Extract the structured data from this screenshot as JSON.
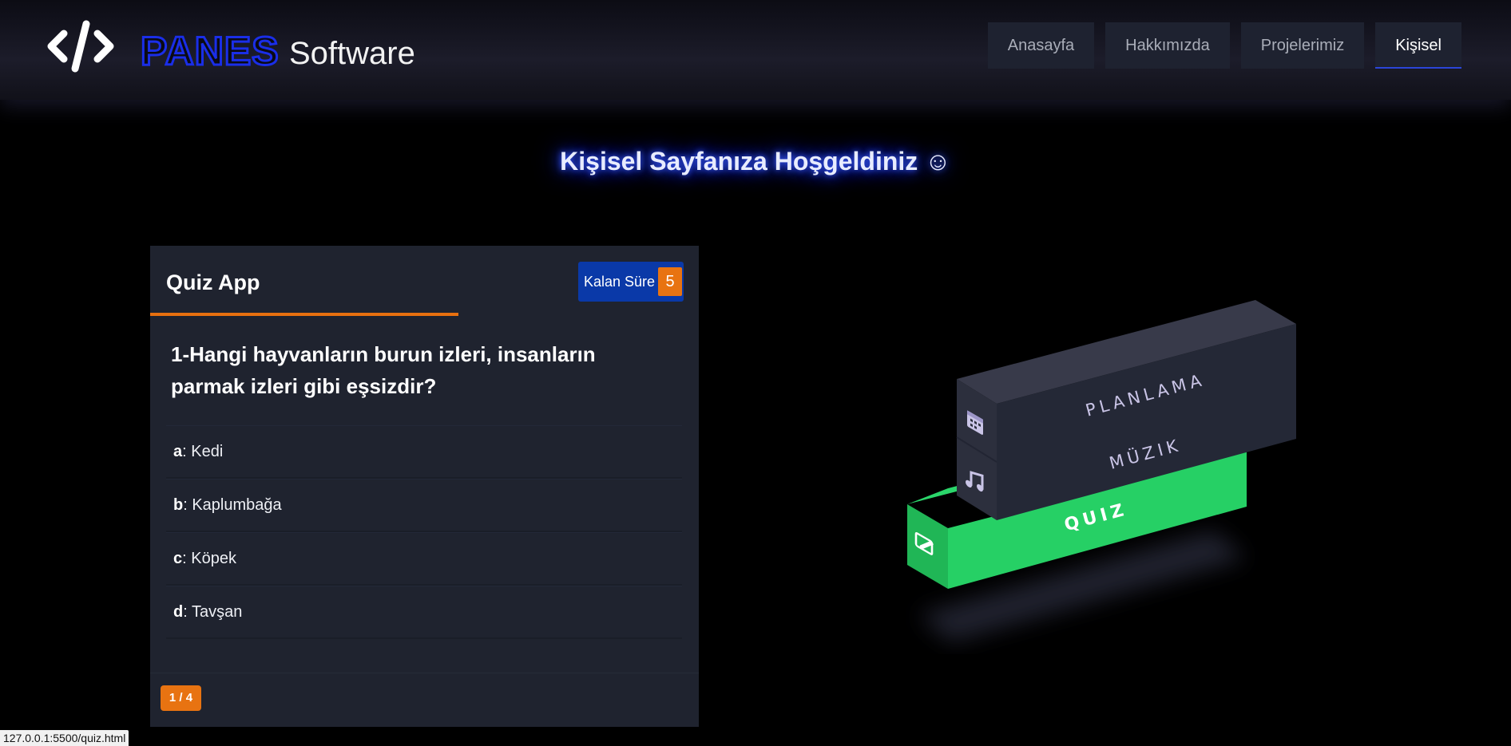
{
  "header": {
    "brand": "PANES",
    "brand_sub": "Software",
    "nav": [
      {
        "label": "Anasayfa",
        "active": false
      },
      {
        "label": "Hakkımızda",
        "active": false
      },
      {
        "label": "Projelerimiz",
        "active": false
      },
      {
        "label": "Kişisel",
        "active": true
      }
    ]
  },
  "welcome": "Kişisel Sayfanıza Hoşgeldiniz ☺",
  "quiz": {
    "title": "Quiz App",
    "timer_label": "Kalan Süre",
    "timer_value": "5",
    "question": "1-Hangi hayvanların burun izleri, insanların parmak izleri gibi eşsizdir?",
    "options": [
      {
        "letter": "a",
        "text": ": Kedi"
      },
      {
        "letter": "b",
        "text": ": Kaplumbağa"
      },
      {
        "letter": "c",
        "text": ": Köpek"
      },
      {
        "letter": "d",
        "text": ": Tavşan"
      }
    ],
    "page": "1 / 4"
  },
  "menu3d": {
    "items": [
      {
        "label": "PLANLAMA",
        "icon": "calendar-icon"
      },
      {
        "label": "MÜZIK",
        "icon": "music-icon"
      },
      {
        "label": "QUIZ",
        "icon": "edit-icon"
      }
    ]
  },
  "status_url": "127.0.0.1:5500/quiz.html",
  "colors": {
    "accent_orange": "#e87311",
    "accent_blue": "#0a39a8",
    "neon_blue": "#2442ff",
    "quiz_green": "#26d065"
  }
}
